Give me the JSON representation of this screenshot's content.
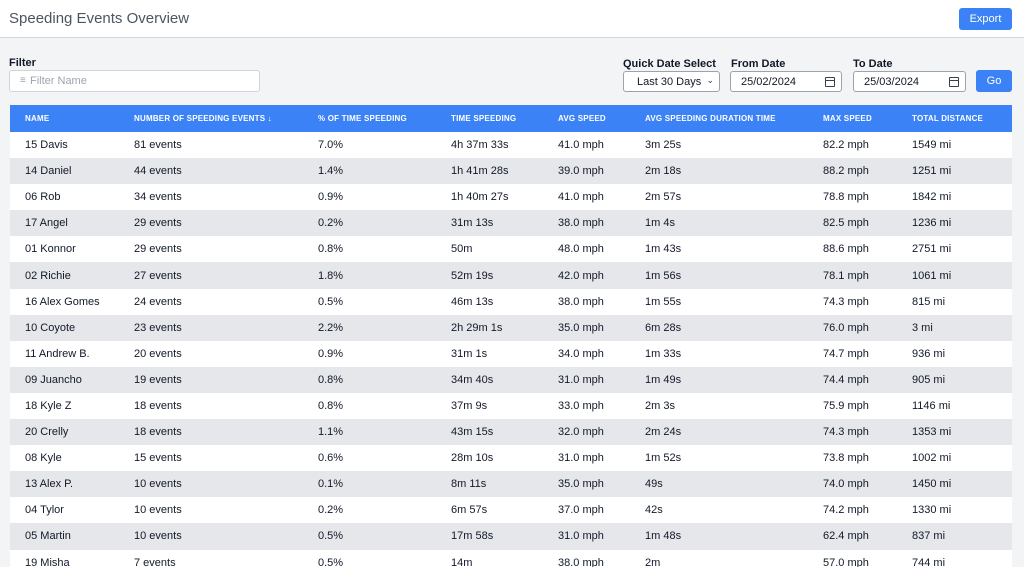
{
  "header": {
    "title": "Speeding Events Overview",
    "export_label": "Export"
  },
  "filter": {
    "label": "Filter",
    "placeholder": "Filter Name",
    "value": "",
    "icon": "filter-lines-icon"
  },
  "controls": {
    "quick_date_label": "Quick Date Select",
    "quick_date_value": "Last 30 Days",
    "from_date_label": "From Date",
    "from_date_value": "25/02/2024",
    "to_date_label": "To Date",
    "to_date_value": "25/03/2024",
    "go_label": "Go"
  },
  "colors": {
    "accent": "#3b82f6",
    "row_alt": "#e5e7eb"
  },
  "table": {
    "columns": [
      "NAME",
      "NUMBER OF SPEEDING EVENTS ↓",
      "% OF TIME SPEEDING",
      "TIME SPEEDING",
      "AVG SPEED",
      "AVG SPEEDING DURATION TIME",
      "MAX SPEED",
      "TOTAL DISTANCE"
    ],
    "sorted_column": "NUMBER OF SPEEDING EVENTS",
    "rows": [
      [
        "15 Davis",
        "81 events",
        "7.0%",
        "4h 37m 33s",
        "41.0 mph",
        "3m 25s",
        "82.2 mph",
        "1549 mi"
      ],
      [
        "14 Daniel",
        "44 events",
        "1.4%",
        "1h 41m 28s",
        "39.0 mph",
        "2m 18s",
        "88.2 mph",
        "1251 mi"
      ],
      [
        "06 Rob",
        "34 events",
        "0.9%",
        "1h 40m 27s",
        "41.0 mph",
        "2m 57s",
        "78.8 mph",
        "1842 mi"
      ],
      [
        "17 Angel",
        "29 events",
        "0.2%",
        "31m 13s",
        "38.0 mph",
        "1m 4s",
        "82.5 mph",
        "1236 mi"
      ],
      [
        "01 Konnor",
        "29 events",
        "0.8%",
        "50m",
        "48.0 mph",
        "1m 43s",
        "88.6 mph",
        "2751 mi"
      ],
      [
        "02 Richie",
        "27 events",
        "1.8%",
        "52m 19s",
        "42.0 mph",
        "1m 56s",
        "78.1 mph",
        "1061 mi"
      ],
      [
        "16 Alex Gomes",
        "24 events",
        "0.5%",
        "46m 13s",
        "38.0 mph",
        "1m 55s",
        "74.3 mph",
        "815 mi"
      ],
      [
        "10 Coyote",
        "23 events",
        "2.2%",
        "2h 29m 1s",
        "35.0 mph",
        "6m 28s",
        "76.0 mph",
        "3 mi"
      ],
      [
        "11 Andrew B.",
        "20 events",
        "0.9%",
        "31m 1s",
        "34.0 mph",
        "1m 33s",
        "74.7 mph",
        "936 mi"
      ],
      [
        "09 Juancho",
        "19 events",
        "0.8%",
        "34m 40s",
        "31.0 mph",
        "1m 49s",
        "74.4 mph",
        "905 mi"
      ],
      [
        "18 Kyle Z",
        "18 events",
        "0.8%",
        "37m 9s",
        "33.0 mph",
        "2m 3s",
        "75.9 mph",
        "1146 mi"
      ],
      [
        "20 Crelly",
        "18 events",
        "1.1%",
        "43m 15s",
        "32.0 mph",
        "2m 24s",
        "74.3 mph",
        "1353 mi"
      ],
      [
        "08 Kyle",
        "15 events",
        "0.6%",
        "28m 10s",
        "31.0 mph",
        "1m 52s",
        "73.8 mph",
        "1002 mi"
      ],
      [
        "13 Alex P.",
        "10 events",
        "0.1%",
        "8m 11s",
        "35.0 mph",
        "49s",
        "74.0 mph",
        "1450 mi"
      ],
      [
        "04 Tylor",
        "10 events",
        "0.2%",
        "6m 57s",
        "37.0 mph",
        "42s",
        "74.2 mph",
        "1330 mi"
      ],
      [
        "05 Martin",
        "10 events",
        "0.5%",
        "17m 58s",
        "31.0 mph",
        "1m 48s",
        "62.4 mph",
        "837 mi"
      ],
      [
        "19 Misha",
        "7 events",
        "0.5%",
        "14m",
        "38.0 mph",
        "2m",
        "57.0 mph",
        "744 mi"
      ]
    ]
  }
}
